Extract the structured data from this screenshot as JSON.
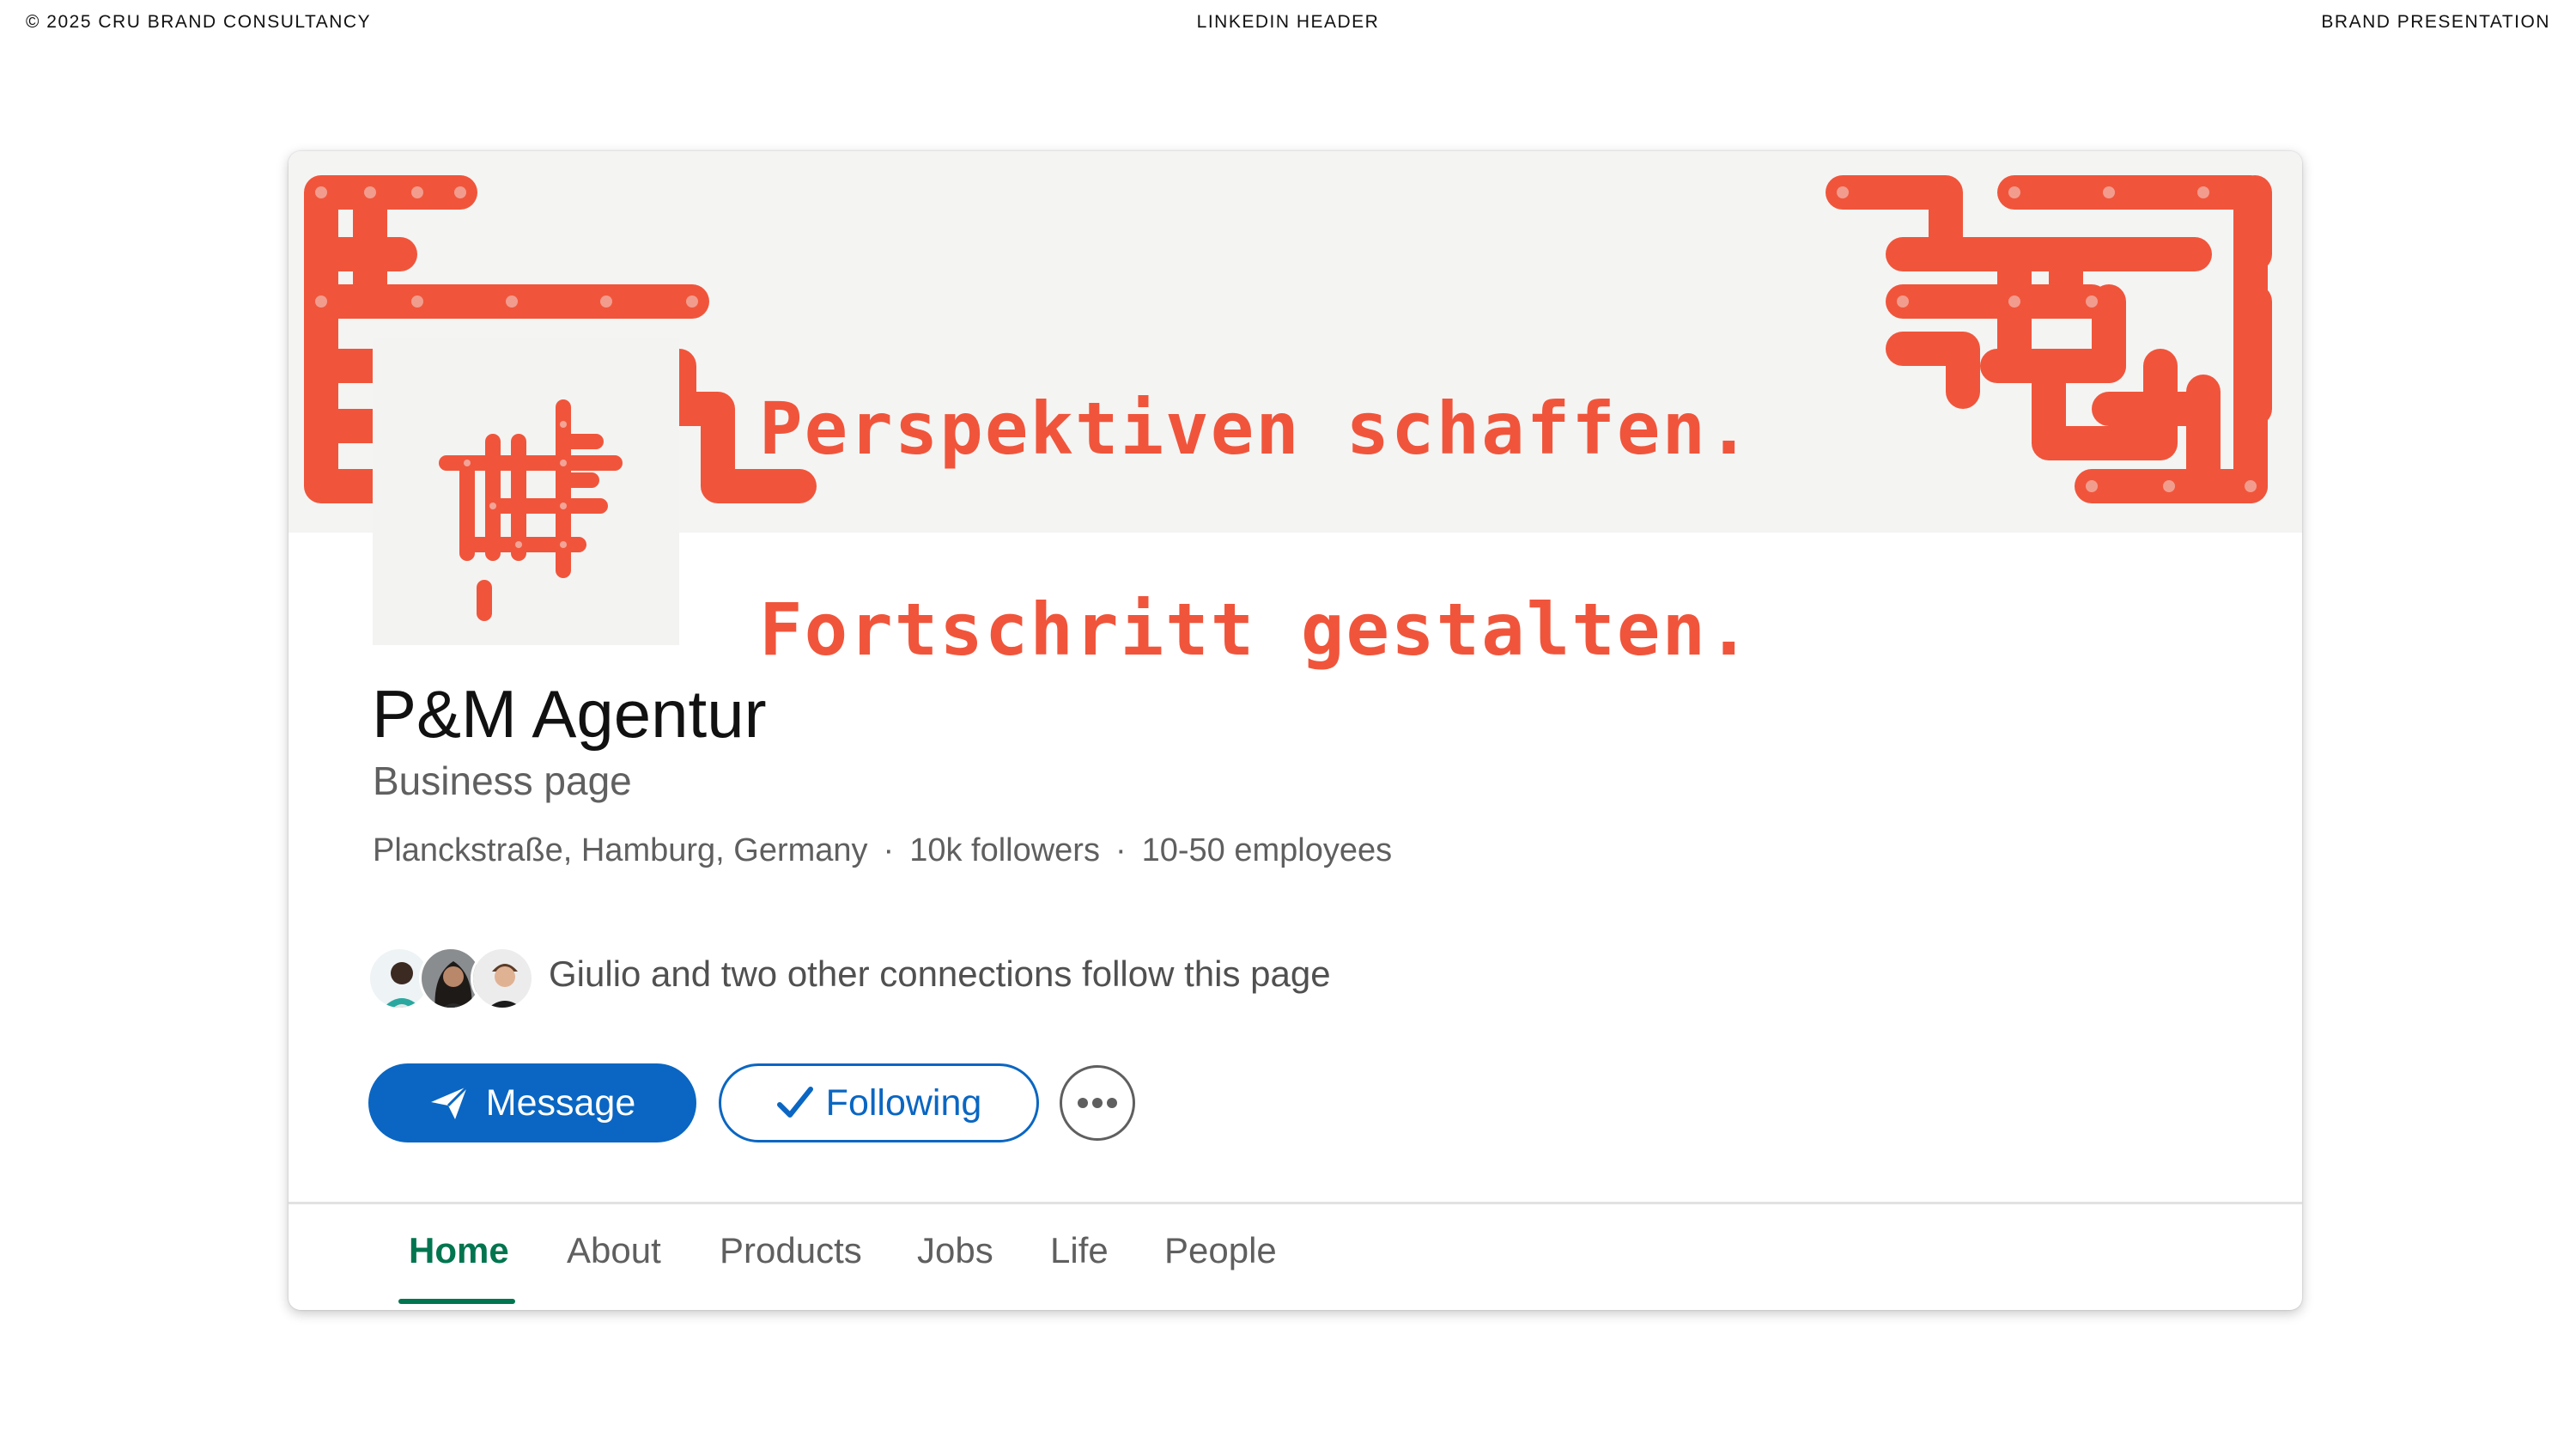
{
  "presentation": {
    "copyright": "© 2025 CRU BRAND CONSULTANCY",
    "section_title": "LINKEDIN HEADER",
    "document_type": "BRAND PRESENTATION"
  },
  "banner": {
    "slogan_line1": "Perspektiven schaffen.",
    "slogan_line2": "Fortschritt gestalten.",
    "accent_color": "#f0553b",
    "background_color": "#f4f4f3"
  },
  "profile": {
    "company_name": "P&M Agentur",
    "page_type": "Business page",
    "location": "Planckstraße, Hamburg, Germany",
    "followers": "10k followers",
    "employees": "10-50 employees",
    "separator": "·",
    "connections_text": "Giulio and two other connections follow this page"
  },
  "actions": {
    "message_label": "Message",
    "message_icon": "send-icon",
    "following_label": "Following",
    "following_icon": "checkmark-icon",
    "more_icon": "more-options-icon",
    "primary_color": "#0a66c2"
  },
  "tabs": {
    "items": [
      "Home",
      "About",
      "Products",
      "Jobs",
      "Life",
      "People"
    ],
    "active": "Home",
    "active_color": "#01754f"
  }
}
